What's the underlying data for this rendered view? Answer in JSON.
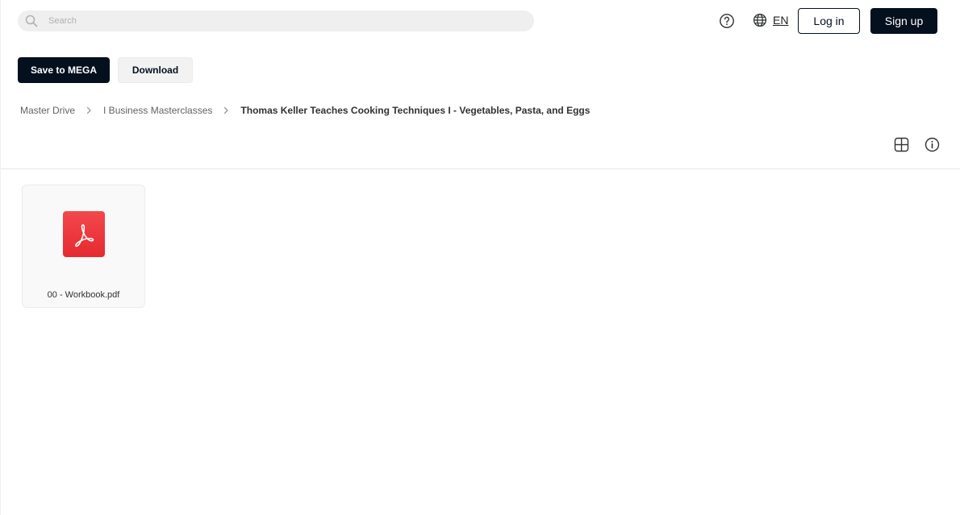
{
  "header": {
    "search_placeholder": "Search",
    "language": "EN",
    "login_label": "Log in",
    "signup_label": "Sign up"
  },
  "actions": {
    "save_label": "Save to MEGA",
    "download_label": "Download"
  },
  "breadcrumb": [
    "Master Drive",
    "I Business Masterclasses",
    "Thomas Keller Teaches Cooking Techniques I - Vegetables, Pasta, and Eggs"
  ],
  "files": [
    {
      "name": "00 - Workbook.pdf",
      "icon": "pdf-icon"
    }
  ],
  "colors": {
    "primary": "#04101e",
    "pdf": "#e8343a",
    "secondary_button": "#f2f2f2"
  }
}
